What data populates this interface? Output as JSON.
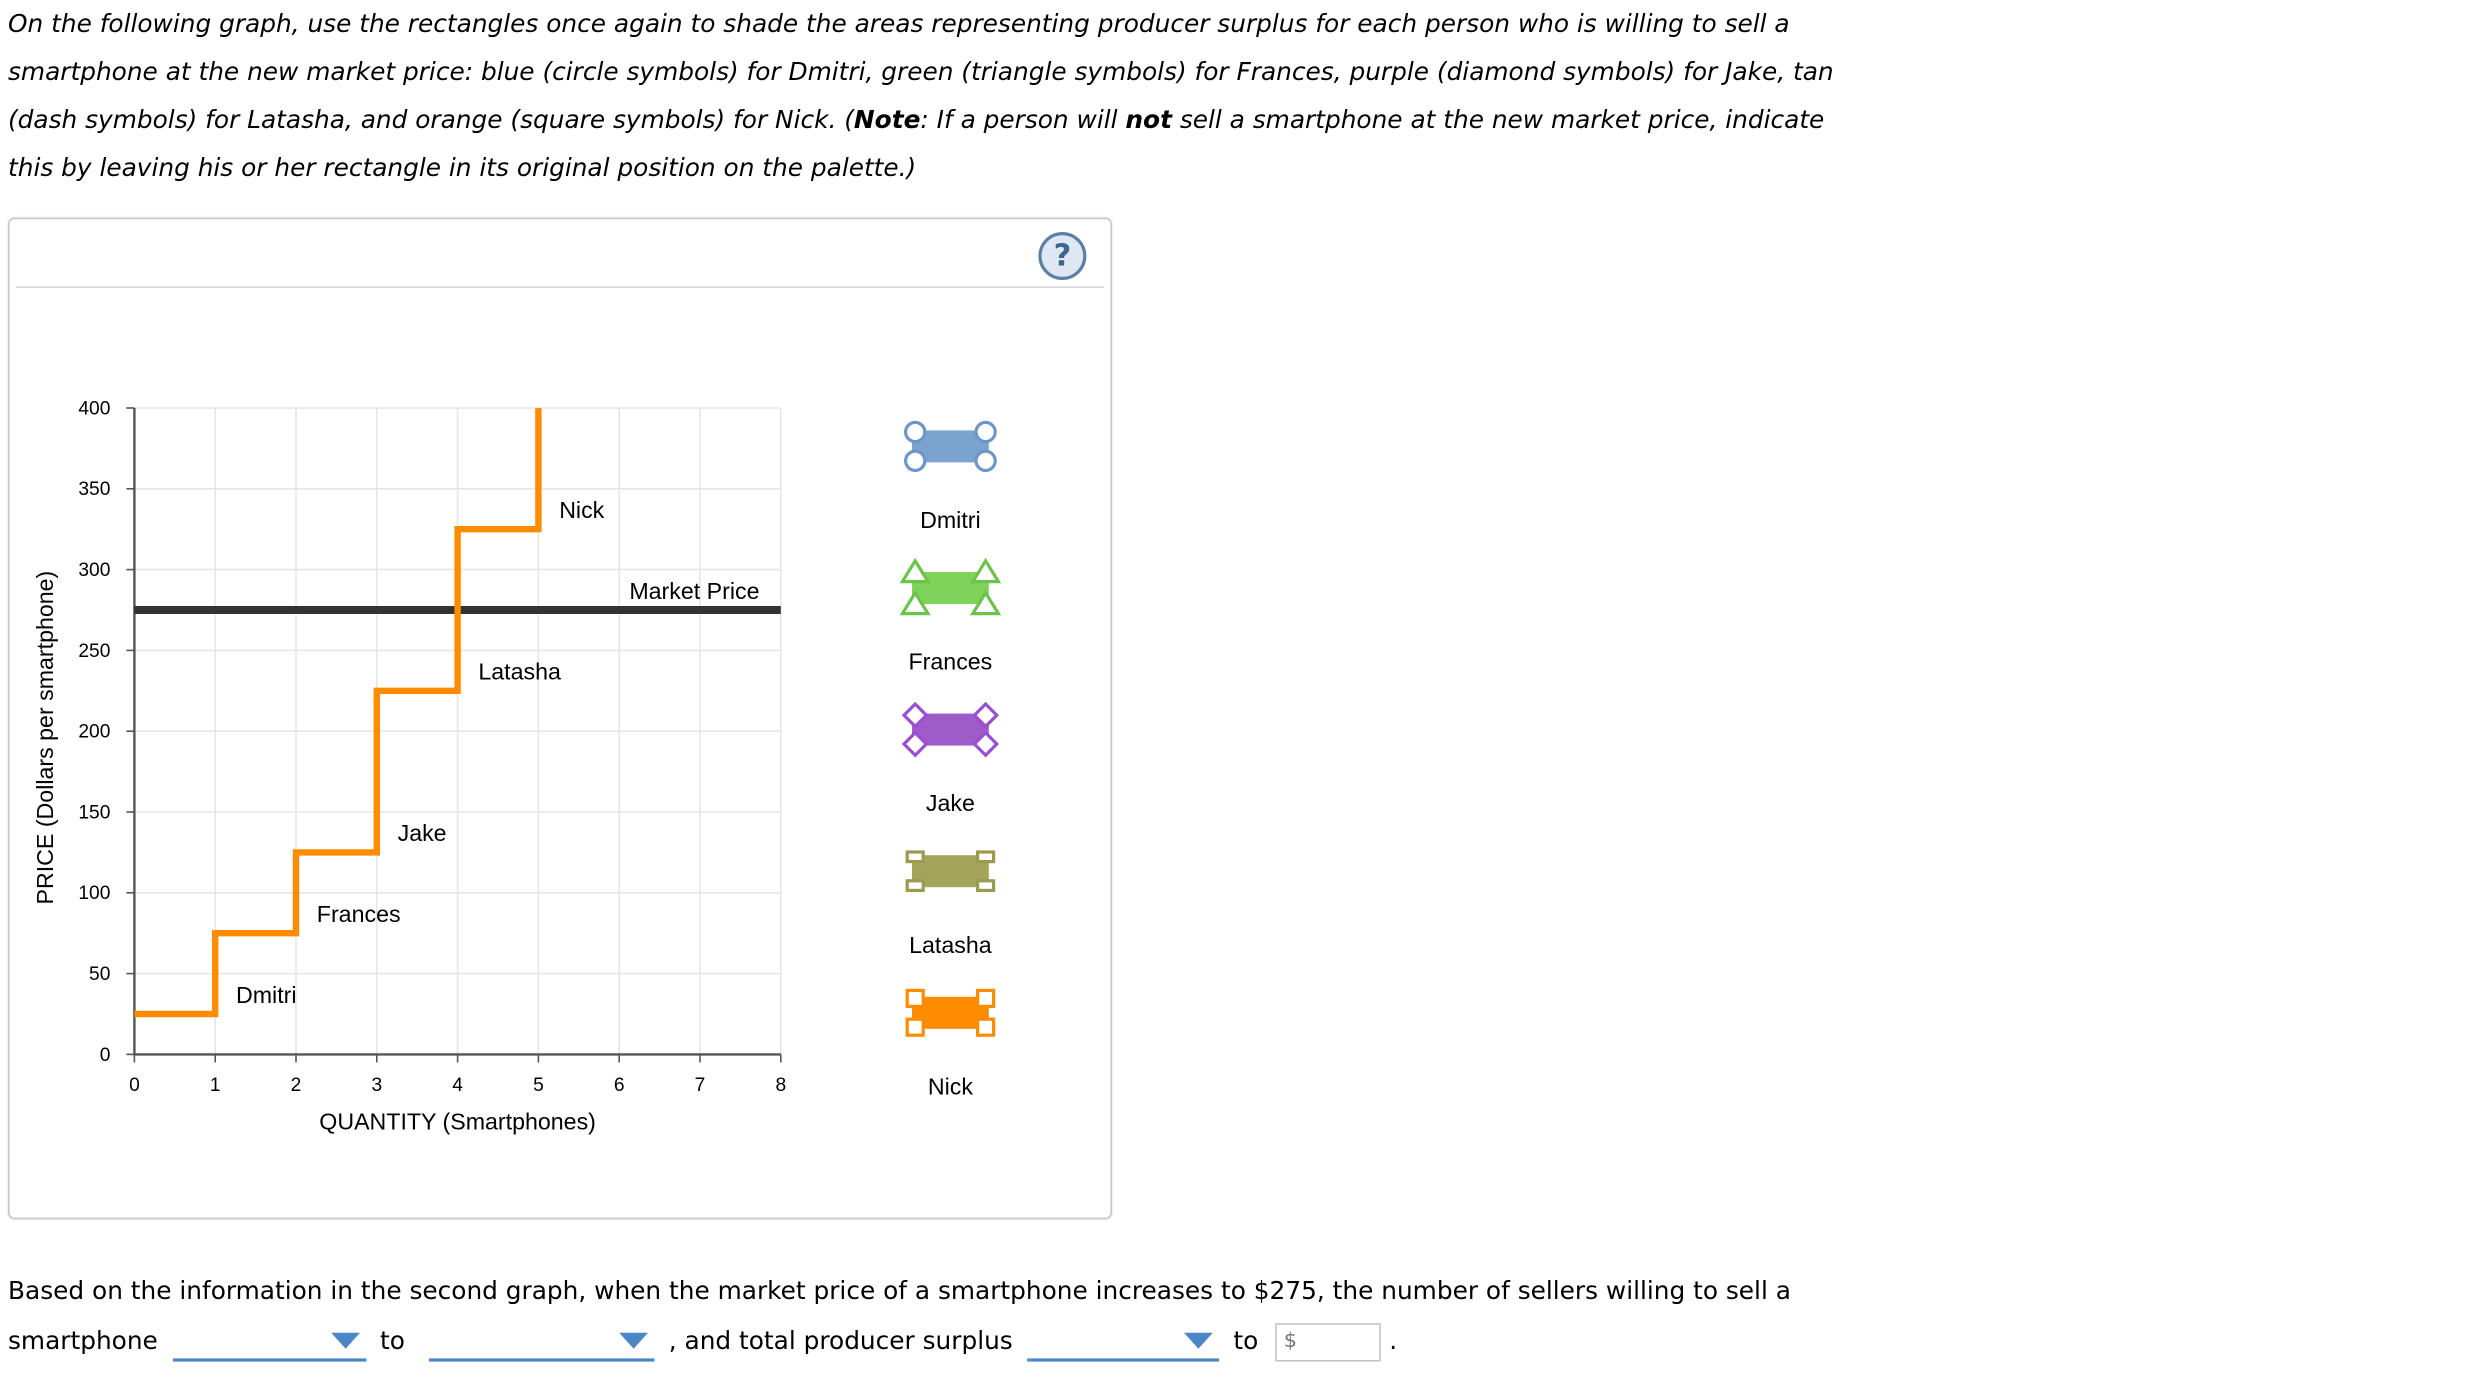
{
  "instructions": {
    "p1": "On the following graph, use the rectangles once again to shade the areas representing producer surplus for each person who is willing to sell a smartphone at the new market price: blue (circle symbols) for Dmitri, green (triangle symbols) for Frances, purple (diamond symbols) for Jake, tan (dash symbols) for Latasha, and orange (square symbols) for Nick. (",
    "note_label": "Note",
    "p2": ": If a person will ",
    "not": "not",
    "p3": " sell a smartphone at the new market price, indicate this by leaving his or her rectangle in its original position on the palette.)"
  },
  "help_icon": "?",
  "chart_data": {
    "type": "line",
    "xlabel": "QUANTITY (Smartphones)",
    "ylabel": "PRICE (Dollars per smartphone)",
    "xlim": [
      0,
      8
    ],
    "ylim": [
      0,
      400
    ],
    "xticks": [
      "0",
      "1",
      "2",
      "3",
      "4",
      "5",
      "6",
      "7",
      "8"
    ],
    "yticks": [
      "0",
      "50",
      "100",
      "150",
      "200",
      "250",
      "300",
      "350",
      "400"
    ],
    "grid": true,
    "supply_color": "#FF8C00",
    "supply_steps": [
      {
        "name": "Dmitri",
        "price": 25
      },
      {
        "name": "Frances",
        "price": 75
      },
      {
        "name": "Jake",
        "price": 125
      },
      {
        "name": "Latasha",
        "price": 225
      },
      {
        "name": "Nick",
        "price": 325
      }
    ],
    "market_price": {
      "label": "Market Price",
      "value": 275,
      "color": "#333333"
    }
  },
  "palette": [
    {
      "name": "Dmitri",
      "color": "#7BA3D0",
      "stroke": "#6A96C8",
      "symbol": "circle"
    },
    {
      "name": "Frances",
      "color": "#7FD35A",
      "stroke": "#6CC34A",
      "symbol": "triangle"
    },
    {
      "name": "Jake",
      "color": "#A05BCB",
      "stroke": "#9A4FD0",
      "symbol": "diamond"
    },
    {
      "name": "Latasha",
      "color": "#A4A55A",
      "stroke": "#9A9B50",
      "symbol": "dash"
    },
    {
      "name": "Nick",
      "color": "#FF8C00",
      "stroke": "#FF8C00",
      "symbol": "square"
    }
  ],
  "question": {
    "line1": "Based on the information in the second graph, when the market price of a smartphone increases to $275, the number of sellers willing to sell a",
    "w1": "smartphone",
    "w2": "to",
    "w3": ", and total producer surplus",
    "w4": "to",
    "w5": ".",
    "input_placeholder": "$"
  }
}
